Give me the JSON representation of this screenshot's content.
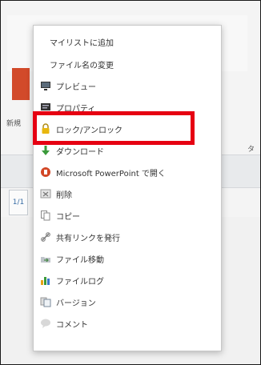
{
  "background": {
    "left_label": "新規",
    "right_label": "タ",
    "pager_text": "1/1"
  },
  "menu": {
    "items": [
      {
        "label": "マイリストに追加",
        "icon": "none"
      },
      {
        "label": "ファイル名の変更",
        "icon": "none"
      },
      {
        "label": "プレビュー",
        "icon": "monitor-icon"
      },
      {
        "label": "プロパティ",
        "icon": "properties-icon"
      },
      {
        "label": "ロック/アンロック",
        "icon": "lock-icon"
      },
      {
        "label": "ダウンロード",
        "icon": "download-icon"
      },
      {
        "label": "Microsoft PowerPoint で開く",
        "icon": "powerpoint-icon"
      },
      {
        "label": "削除",
        "icon": "delete-icon"
      },
      {
        "label": "コピー",
        "icon": "copy-icon"
      },
      {
        "label": "共有リンクを発行",
        "icon": "link-icon"
      },
      {
        "label": "ファイル移動",
        "icon": "move-icon"
      },
      {
        "label": "ファイルログ",
        "icon": "log-icon"
      },
      {
        "label": "バージョン",
        "icon": "version-icon"
      },
      {
        "label": "コメント",
        "icon": "comment-icon"
      }
    ],
    "highlighted_item": "ロック/アンロック",
    "highlight_color": "#e60012"
  }
}
